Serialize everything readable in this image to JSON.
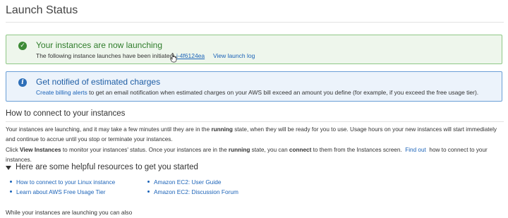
{
  "page": {
    "title": "Launch Status"
  },
  "success_alert": {
    "heading": "Your instances are now launching",
    "body_prefix": "The following instance launches have been initiated:",
    "instance_id": "i-4f6124ea",
    "view_log": "View launch log"
  },
  "info_alert": {
    "heading": "Get notified of estimated charges",
    "billing_link": "Create billing alerts",
    "body_suffix": "to get an email notification when estimated charges on your AWS bill exceed an amount you define (for example, if you exceed the free usage tier)."
  },
  "connect": {
    "heading": "How to connect to your instances",
    "p1_a": "Your instances are launching, and it may take a few minutes until they are in the",
    "p1_running": "running",
    "p1_b": "state, when they will be ready for you to use. Usage hours on your new instances will start immediately and continue to accrue until you stop or terminate your instances.",
    "p2_a": "Click",
    "p2_view": "View Instances",
    "p2_b": "to monitor your instances' status. Once your instances are in the",
    "p2_running": "running",
    "p2_c": "state, you can",
    "p2_connect": "connect",
    "p2_d": "to them from the Instances screen.",
    "p2_findout": "Find out",
    "p2_e": "how to connect to your instances."
  },
  "resources": {
    "heading": "Here are some helpful resources to get you started",
    "left": [
      "How to connect to your Linux instance",
      "Learn about AWS Free Usage Tier"
    ],
    "right": [
      "Amazon EC2: User Guide",
      "Amazon EC2: Discussion Forum"
    ]
  },
  "footer": {
    "text": "While your instances are launching you can also"
  },
  "colors": {
    "success_green": "#3c8a36",
    "info_blue": "#2e6fb8",
    "link_blue": "#1b63b8"
  },
  "icons": {
    "success": "check-circle-icon",
    "info": "info-circle-icon",
    "caret": "caret-down-icon",
    "cursor": "hand-pointer-icon"
  }
}
